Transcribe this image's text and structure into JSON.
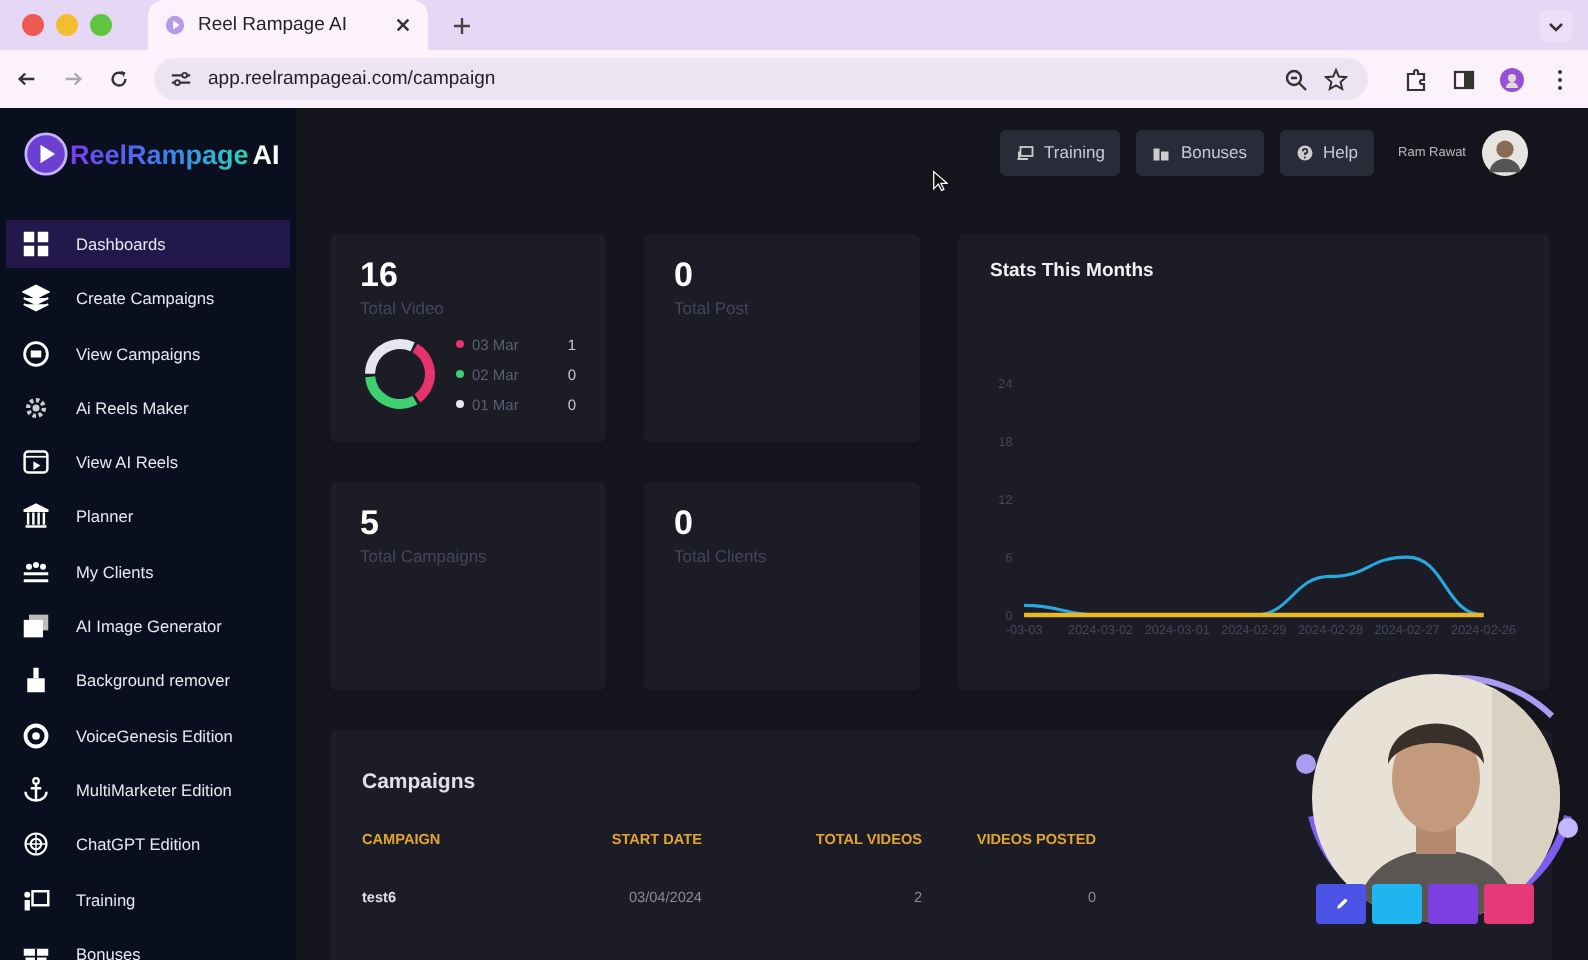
{
  "browser": {
    "tab_title": "Reel Rampage AI",
    "url": "app.reelrampageai.com/campaign"
  },
  "logo": {
    "name": "ReelRampage",
    "suffix": "AI"
  },
  "sidebar": {
    "items": [
      {
        "label": "Dashboards",
        "selected": true
      },
      {
        "label": "Create Campaigns",
        "selected": false
      },
      {
        "label": "View Campaigns",
        "selected": false
      },
      {
        "label": "Ai Reels Maker",
        "selected": false
      },
      {
        "label": "View AI Reels",
        "selected": false
      },
      {
        "label": "Planner",
        "selected": false
      },
      {
        "label": "My Clients",
        "selected": false
      },
      {
        "label": "AI Image Generator",
        "selected": false
      },
      {
        "label": "Background remover",
        "selected": false
      },
      {
        "label": "VoiceGenesis Edition",
        "selected": false
      },
      {
        "label": "MultiMarketer Edition",
        "selected": false
      },
      {
        "label": "ChatGPT Edition",
        "selected": false
      },
      {
        "label": "Training",
        "selected": false
      },
      {
        "label": "Bonuses",
        "selected": false
      }
    ]
  },
  "header": {
    "buttons": [
      "Training",
      "Bonuses",
      "Help"
    ],
    "user_name": "Ram Rawat"
  },
  "stats": [
    {
      "value": "16",
      "label": "Total Video",
      "legend": [
        {
          "label": "03 Mar",
          "value": "1",
          "color": "#e5336b"
        },
        {
          "label": "02 Mar",
          "value": "0",
          "color": "#3ecf6e"
        },
        {
          "label": "01 Mar",
          "value": "0",
          "color": "#e6e6ee"
        }
      ]
    },
    {
      "value": "0",
      "label": "Total Post"
    },
    {
      "value": "5",
      "label": "Total Campaigns"
    },
    {
      "value": "0",
      "label": "Total Clients"
    }
  ],
  "stats_chart": {
    "title": "Stats This Months",
    "chart_data": {
      "type": "line",
      "categories": [
        "-03-03",
        "2024-03-02",
        "2024-03-01",
        "2024-02-29",
        "2024-02-28",
        "2024-02-27",
        "2024-02-26"
      ],
      "ylim": [
        0,
        24
      ],
      "yticks": [
        0,
        6,
        12,
        18,
        24
      ],
      "series": [
        {
          "color": "#29a8e0",
          "values": [
            1,
            0,
            0,
            0,
            4,
            6,
            0
          ]
        },
        {
          "color": "#e8b923",
          "values": [
            0,
            0,
            0,
            0,
            0,
            0,
            0
          ]
        }
      ]
    }
  },
  "campaigns": {
    "title": "Campaigns",
    "columns": [
      "CAMPAIGN",
      "START DATE",
      "TOTAL VIDEOS",
      "VIDEOS POSTED"
    ],
    "rows": [
      [
        "test6",
        "03/04/2024",
        "2",
        "0"
      ]
    ]
  }
}
